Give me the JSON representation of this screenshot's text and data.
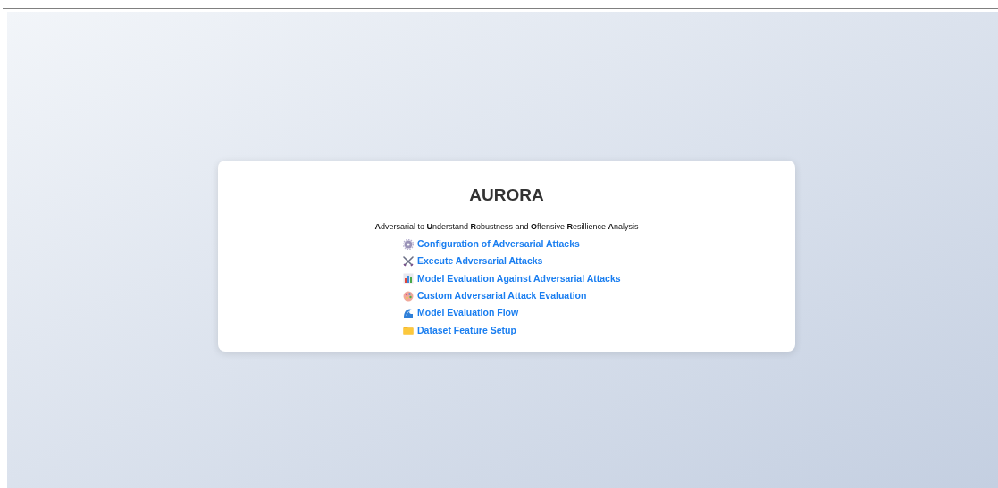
{
  "title": "AURORA",
  "subtitle": "**A**dversarial to **U**nderstand **R**obustness and **O**ffensive **R**esillience **A**nalysis",
  "links": [
    {
      "kind": "gear",
      "label": "Configuration of Adversarial Attacks"
    },
    {
      "kind": "swords",
      "label": "Execute Adversarial Attacks"
    },
    {
      "kind": "chart",
      "label": "Model Evaluation Against Adversarial Attacks"
    },
    {
      "kind": "palette",
      "label": "Custom Adversarial Attack Evaluation"
    },
    {
      "kind": "wave",
      "label": "Model Evaluation Flow"
    },
    {
      "kind": "folder",
      "label": "Dataset Feature Setup"
    }
  ]
}
